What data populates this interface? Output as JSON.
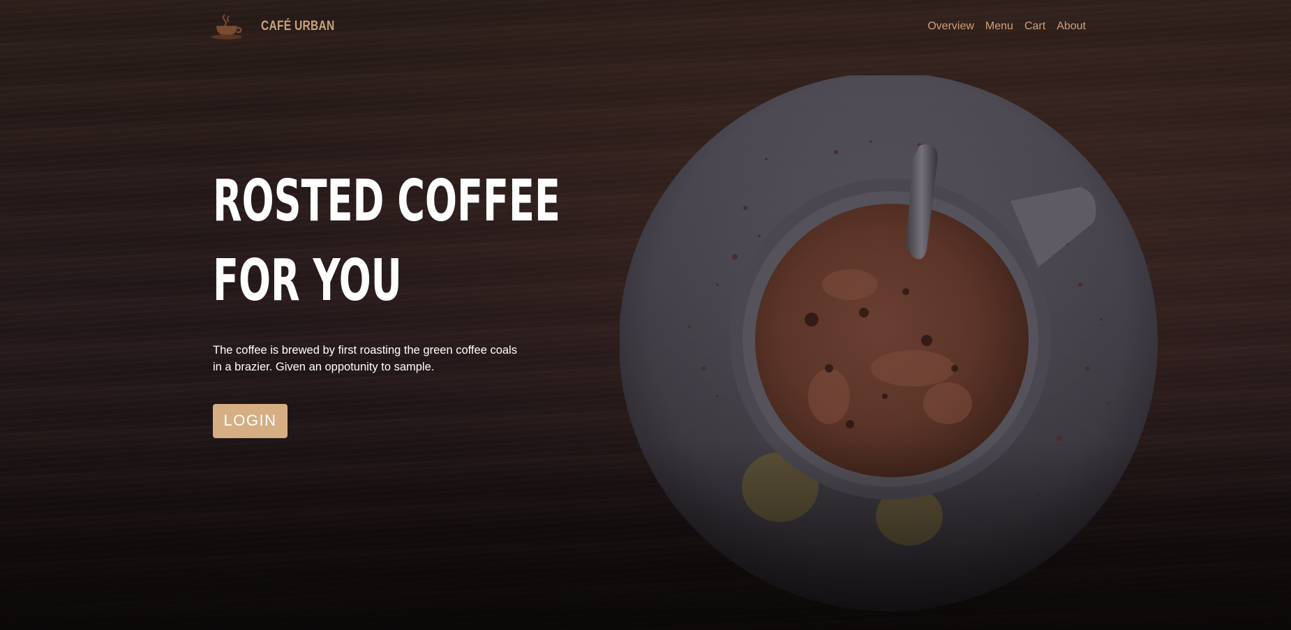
{
  "brand": {
    "name": "CAFÉ URBAN",
    "logo_icon": "coffee-cup-icon"
  },
  "nav": {
    "items": [
      {
        "label": "Overview"
      },
      {
        "label": "Menu"
      },
      {
        "label": "Cart"
      },
      {
        "label": "About"
      }
    ]
  },
  "hero": {
    "title_line1": "ROSTED COFFEE",
    "title_line2": "FOR YOU",
    "description": "The coffee is brewed by first roasting the green coffee coals in a brazier. Given an oppotunity to sample.",
    "login_label": "LOGIN"
  },
  "colors": {
    "accent": "#d6ae83",
    "nav_text": "#d0a07a",
    "brand_text": "#c9a27e",
    "background": "#24181a"
  }
}
